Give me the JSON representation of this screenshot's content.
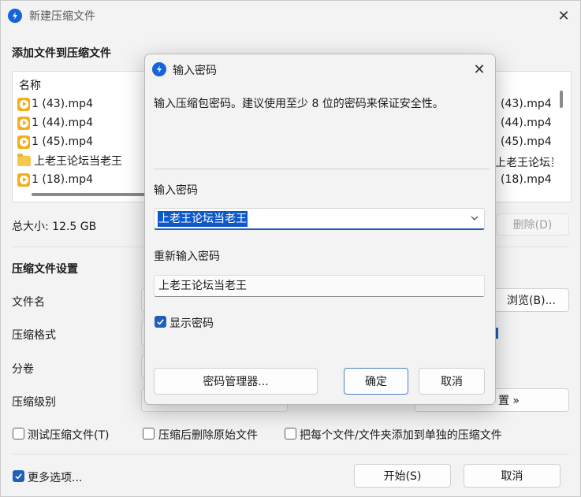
{
  "main": {
    "title": "新建压缩文件",
    "section_add": "添加文件到压缩文件",
    "list_header": "名称",
    "files": [
      {
        "name": "1 (43).mp4",
        "type": "mp4"
      },
      {
        "name": "1 (44).mp4",
        "type": "mp4"
      },
      {
        "name": "1 (45).mp4",
        "type": "mp4"
      },
      {
        "name": "上老王论坛当老王",
        "type": "folder"
      },
      {
        "name": "1 (18).mp4",
        "type": "mp4"
      }
    ],
    "right_column": [
      "(43).mp4",
      "(44).mp4",
      "(45).mp4",
      "上老王论坛当老王",
      "(18).mp4"
    ],
    "total_size": "总大小: 12.5 GB",
    "delete_button": "删除(D)",
    "section_settings": "压缩文件设置",
    "label_filename": "文件名",
    "browse_button": "浏览(B)...",
    "label_format": "压缩格式",
    "label_split": "分卷",
    "label_level": "压缩级别",
    "settings_button_partial": "置 »",
    "check_test": "测试压缩文件(T)",
    "check_delete_after": "压缩后删除原始文件",
    "check_separate": "把每个文件/文件夹添加到单独的压缩文件",
    "check_more_options": "更多选项...",
    "start_button": "开始(S)",
    "cancel_button": "取消"
  },
  "dialog": {
    "title": "输入密码",
    "description": "输入压缩包密码。建议使用至少 8 位的密码来保证安全性。",
    "label_password": "输入密码",
    "password_value": "上老王论坛当老王",
    "label_repeat": "重新输入密码",
    "repeat_value": "上老王论坛当老王",
    "show_password": "显示密码",
    "show_password_checked": true,
    "manager_button": "密码管理器...",
    "ok_button": "确定",
    "cancel_button": "取消"
  },
  "colors": {
    "accent": "#1f5fb8",
    "app_icon": "#1565d8",
    "selection": "#0f59c7",
    "mp4_icon": "#f2b01e",
    "folder_icon": "#f5c84c"
  },
  "icons": {
    "app": "app-logo-icon",
    "close": "close-icon",
    "mp4": "video-file-icon",
    "folder": "folder-icon",
    "dropdown": "chevron-down-icon",
    "check": "checkmark-icon"
  }
}
